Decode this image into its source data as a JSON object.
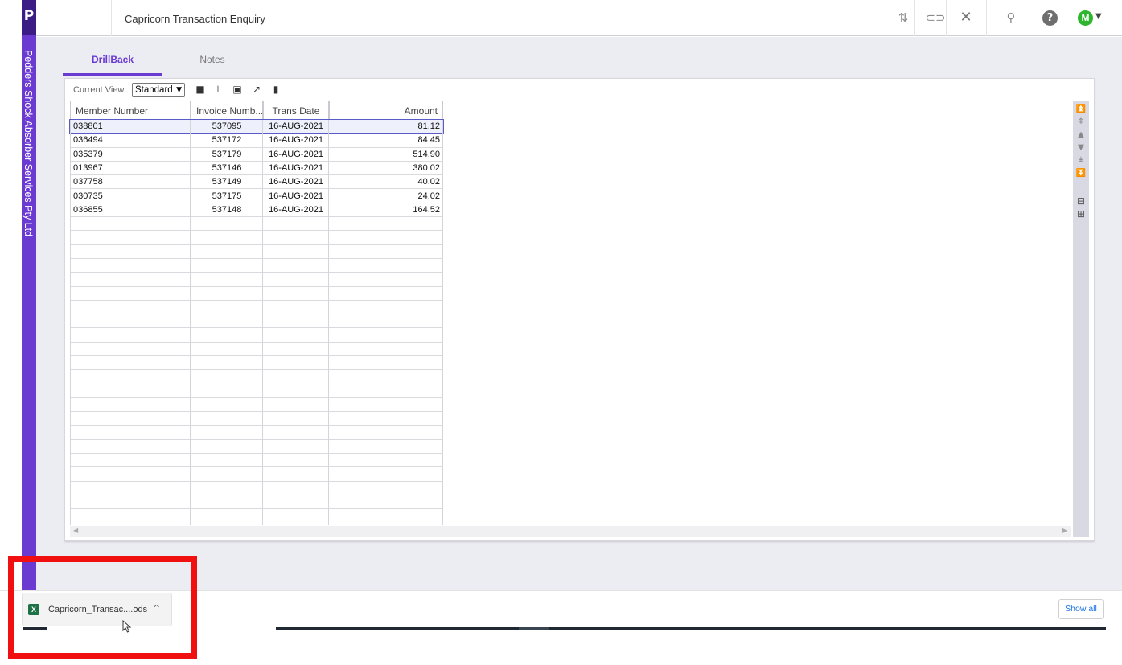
{
  "header": {
    "logo": "P",
    "title": "Capricorn Transaction Enquiry",
    "avatar_initial": "M"
  },
  "rail": {
    "company": "Pedders Shock Absorber Services Pty Ltd"
  },
  "tabs": [
    {
      "label": "DrillBack",
      "active": true
    },
    {
      "label": "Notes",
      "active": false
    }
  ],
  "toolbar": {
    "current_view_label": "Current View:",
    "current_view_value": "Standard"
  },
  "grid": {
    "columns": [
      "Member Number",
      "Invoice Numb...",
      "Trans Date",
      "Amount"
    ],
    "rows": [
      [
        "038801",
        "537095",
        "16-AUG-2021",
        "81.12"
      ],
      [
        "036494",
        "537172",
        "16-AUG-2021",
        "84.45"
      ],
      [
        "035379",
        "537179",
        "16-AUG-2021",
        "514.90"
      ],
      [
        "013967",
        "537146",
        "16-AUG-2021",
        "380.02"
      ],
      [
        "037758",
        "537149",
        "16-AUG-2021",
        "40.02"
      ],
      [
        "030735",
        "537175",
        "16-AUG-2021",
        "24.02"
      ],
      [
        "036855",
        "537148",
        "16-AUG-2021",
        "164.52"
      ]
    ],
    "empty_rows": 22,
    "selected_row": 0
  },
  "download": {
    "filename": "Capricorn_Transac....ods",
    "show_all": "Show all"
  },
  "colors": {
    "accent": "#6a3ad1",
    "highlight": "#f01010"
  }
}
